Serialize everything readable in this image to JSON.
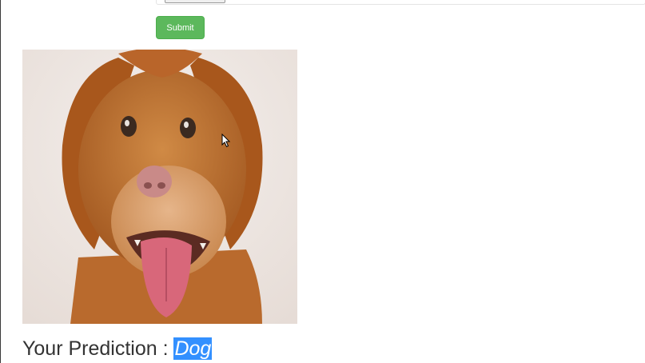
{
  "upload_form": {
    "submit_label": "Submit"
  },
  "image": {
    "subject": "dog photo"
  },
  "prediction": {
    "label": "Your Prediction : ",
    "value": "Dog"
  },
  "colors": {
    "submit": "#5cb85c",
    "selection": "#3390ff",
    "text": "#333333"
  }
}
